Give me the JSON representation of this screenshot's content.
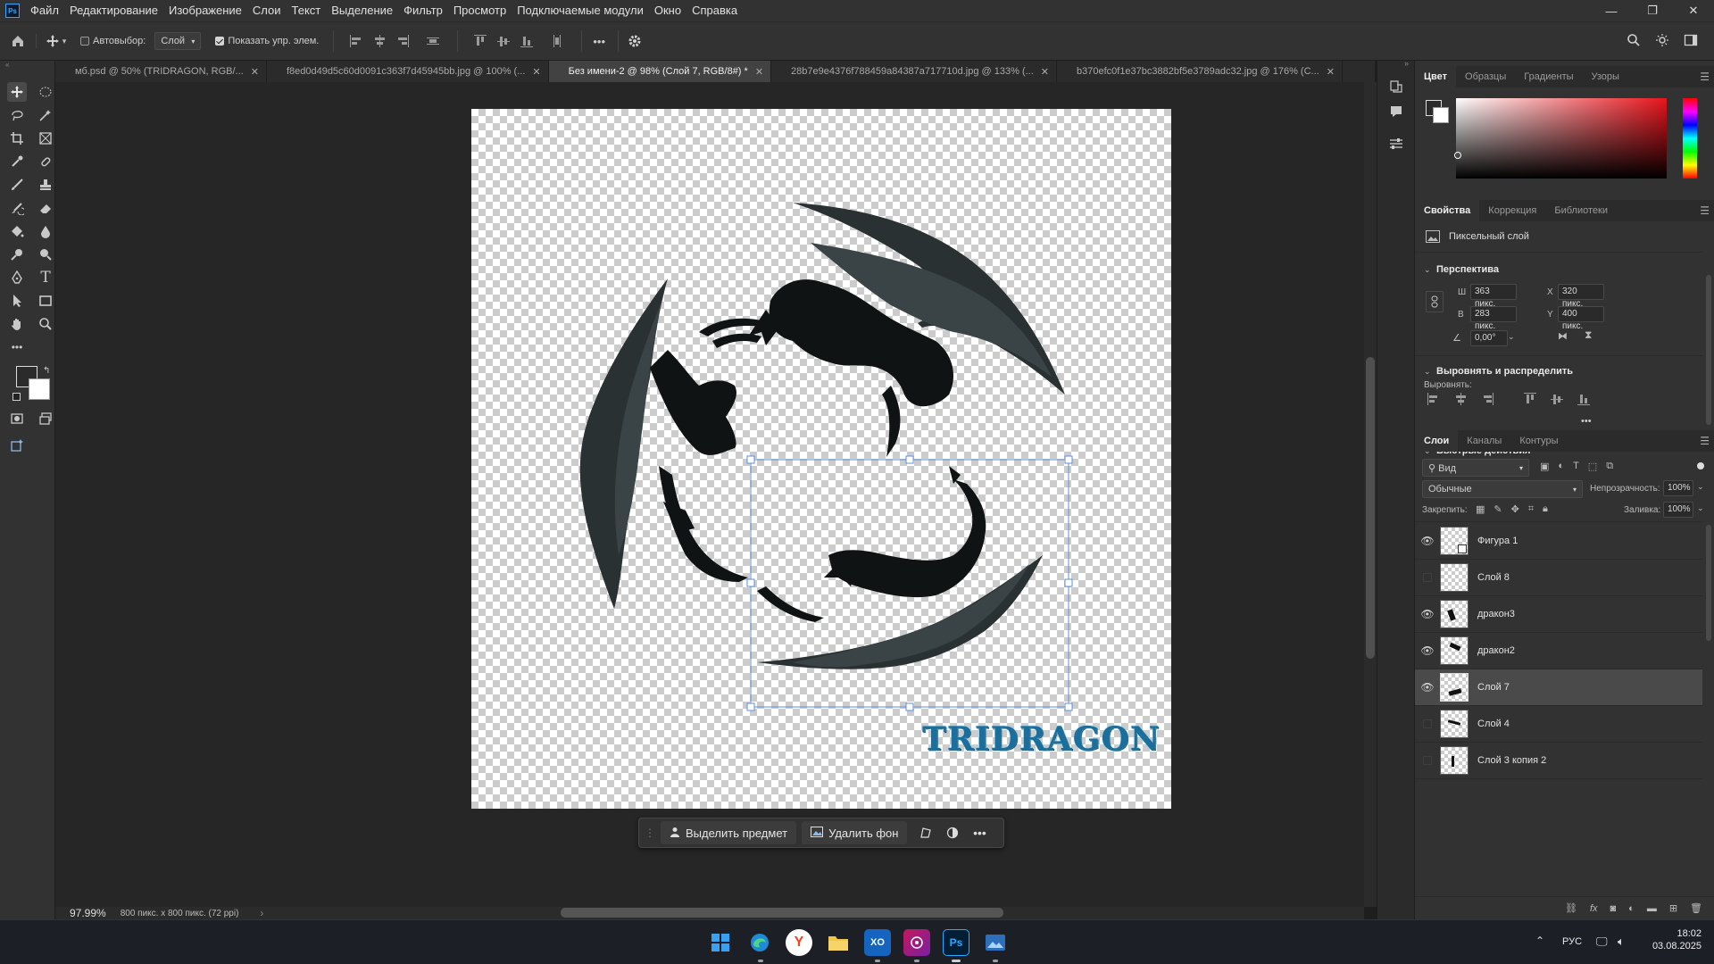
{
  "app": {
    "logo": "Ps"
  },
  "menu": [
    "Файл",
    "Редактирование",
    "Изображение",
    "Слои",
    "Текст",
    "Выделение",
    "Фильтр",
    "Просмотр",
    "Подключаемые модули",
    "Окно",
    "Справка"
  ],
  "window_controls": {
    "minimize": "—",
    "restore": "❐",
    "close": "✕"
  },
  "options": {
    "autoselect_label": "Автовыбор:",
    "autoselect_value": "Слой",
    "show_transform_label": "Показать упр. элем.",
    "more_label": "•••"
  },
  "tabs": [
    {
      "label": "мб.psd @ 50% (TRIDRAGON, RGB/...",
      "active": false
    },
    {
      "label": "f8ed0d49d5c60d0091c363f7d45945bb.jpg @ 100% (...",
      "active": false
    },
    {
      "label": "Без имени-2 @ 98% (Слой 7, RGB/8#) *",
      "active": true
    },
    {
      "label": "28b7e9e4376f788459a84387a717710d.jpg @ 133% (...",
      "active": false
    },
    {
      "label": "b370efc0f1e37bc3882bf5e3789adc32.jpg @ 176% (C...",
      "active": false
    }
  ],
  "canvas": {
    "logo_text": "TRIDRAGON"
  },
  "status": {
    "zoom": "97.99%",
    "info": "800 пикс. x 800 пикс. (72 ppi)"
  },
  "context_bar": {
    "select_subject": "Выделить предмет",
    "remove_bg": "Удалить фон",
    "more": "•••"
  },
  "color_panel": {
    "tabs": [
      "Цвет",
      "Образцы",
      "Градиенты",
      "Узоры"
    ]
  },
  "properties_panel": {
    "tabs": [
      "Свойства",
      "Коррекция",
      "Библиотеки"
    ],
    "layer_type": "Пиксельный слой",
    "perspective_header": "Перспектива",
    "w_label": "Ш",
    "w_value": "363 пикс.",
    "h_label": "В",
    "h_value": "283 пикс.",
    "x_label": "X",
    "x_value": "320 пикс.",
    "y_label": "Y",
    "y_value": "400 пикс.",
    "angle_value": "0,00°",
    "align_header": "Выровнять и распределить",
    "align_label": "Выровнять:",
    "quick_actions_header": "Быстрые действия",
    "dots": "•••"
  },
  "layers_panel": {
    "tabs": [
      "Слои",
      "Каналы",
      "Контуры"
    ],
    "filter_label": "Вид",
    "blend_mode": "Обычные",
    "opacity_label": "Непрозрачность:",
    "opacity_value": "100%",
    "lock_label": "Закрепить:",
    "fill_label": "Заливка:",
    "fill_value": "100%",
    "layers": [
      {
        "name": "Фигура 1",
        "visible": true,
        "selected": false
      },
      {
        "name": "Слой 8",
        "visible": false,
        "selected": false
      },
      {
        "name": "дракон3",
        "visible": true,
        "selected": false
      },
      {
        "name": "дракон2",
        "visible": true,
        "selected": false
      },
      {
        "name": "Слой 7",
        "visible": true,
        "selected": true
      },
      {
        "name": "Слой 4",
        "visible": false,
        "selected": false
      },
      {
        "name": "Слой 3 копия 2",
        "visible": false,
        "selected": false
      }
    ]
  },
  "system_tray": {
    "language": "РУС",
    "time": "18:02",
    "date": "03.08.2025"
  },
  "taskbar_apps": [
    {
      "icon": "windows-start-icon"
    },
    {
      "icon": "edge-browser-icon"
    },
    {
      "icon": "yandex-browser-icon",
      "label": "Y"
    },
    {
      "icon": "file-explorer-icon"
    },
    {
      "icon": "xbox-app-icon",
      "label": "XO"
    },
    {
      "icon": "game-app-icon"
    },
    {
      "icon": "photoshop-icon",
      "label": "Ps"
    },
    {
      "icon": "image-viewer-icon"
    }
  ],
  "colors": {
    "accent": "#31a8ff",
    "selection_box": "#5b8fdc",
    "panel_bg": "#323232",
    "canvas_bg": "#262626"
  }
}
